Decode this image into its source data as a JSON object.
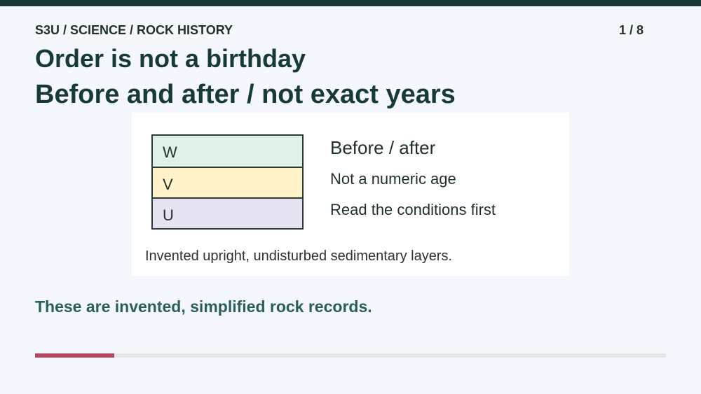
{
  "header": {
    "breadcrumb": "S3U / SCIENCE / ROCK HISTORY",
    "page_counter": "1 / 8",
    "title": "Order is not a birthday",
    "subtitle": "Before and after / not exact years"
  },
  "card": {
    "layers": [
      {
        "label": "W",
        "color": "#e2f1e7"
      },
      {
        "label": "V",
        "color": "#fff2c9"
      },
      {
        "label": "U",
        "color": "#e6e3f3"
      }
    ],
    "bullets": [
      "Before / after",
      "Not a numeric age",
      "Read the conditions first"
    ],
    "caption": "Invented upright, undisturbed sedimentary layers."
  },
  "note": "These are invented, simplified rock records.",
  "progress": {
    "current": 1,
    "total": 8,
    "fraction": 0.125,
    "fill_color": "#b5495f"
  },
  "colors": {
    "accent_dark": "#173a36",
    "note_text": "#2a5e5c"
  }
}
